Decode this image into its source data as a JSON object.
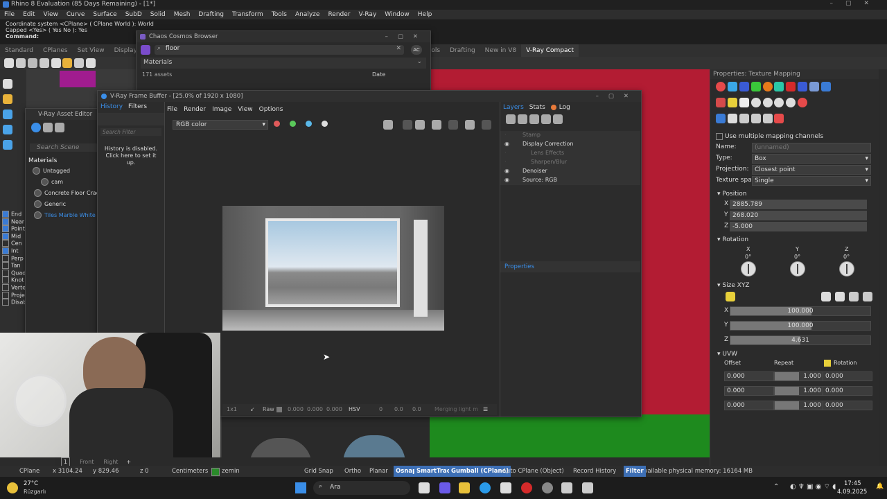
{
  "app": {
    "title": "Rhino 8 Evaluation (85 Days Remaining) - [1*]",
    "menu": [
      "File",
      "Edit",
      "View",
      "Curve",
      "Surface",
      "SubD",
      "Solid",
      "Mesh",
      "Drafting",
      "Transform",
      "Tools",
      "Analyze",
      "Render",
      "V-Ray",
      "Window",
      "Help"
    ]
  },
  "command": {
    "lines": [
      "Coordinate system <CPlane> ( CPlane World ): World",
      "Capped <Yes> ( Yes No ): Yes"
    ],
    "prompt": "Command:"
  },
  "tabs": [
    "Standard",
    "CPlanes",
    "Set View",
    "Display",
    "Tools",
    "Render Tools",
    "Drafting",
    "New in V8",
    "V-Ray Compact"
  ],
  "viewport_tabs": [
    "1",
    "Front",
    "Right"
  ],
  "osnaps": [
    {
      "label": "End",
      "checked": true
    },
    {
      "label": "Near",
      "checked": true
    },
    {
      "label": "Point",
      "checked": true
    },
    {
      "label": "Mid",
      "checked": true
    },
    {
      "label": "Cen",
      "checked": false
    },
    {
      "label": "Int",
      "checked": true
    },
    {
      "label": "Perp",
      "checked": false
    },
    {
      "label": "Tan",
      "checked": false
    },
    {
      "label": "Quad",
      "checked": false
    },
    {
      "label": "Knot",
      "checked": false
    },
    {
      "label": "Vertex",
      "checked": false
    },
    {
      "label": "Project",
      "checked": false
    },
    {
      "label": "Disable",
      "checked": false
    }
  ],
  "cosmos": {
    "title": "Chaos Cosmos Browser",
    "search": "floor",
    "badge": "AC",
    "category": "Materials",
    "count": "171 assets",
    "sort": "Date"
  },
  "asset_editor": {
    "title": "V-Ray Asset Editor",
    "search_placeholder": "Search Scene",
    "header": "Materials",
    "items": [
      "Untagged",
      "cam",
      "Concrete Floor Crack",
      "Generic",
      "Tiles Marble White"
    ]
  },
  "vfb": {
    "title": "V-Ray Frame Buffer - [25.0% of 1920 x 1080]",
    "left_tabs": [
      "History",
      "Filters"
    ],
    "search_placeholder": "Search Filter",
    "history_msg": "History is disabled. Click here to set it up.",
    "menu": [
      "File",
      "Render",
      "Image",
      "View",
      "Options"
    ],
    "channel": "RGB color",
    "right_tabs": [
      "Layers",
      "Stats",
      "Log"
    ],
    "layers": [
      {
        "label": "Stamp",
        "active": false
      },
      {
        "label": "Display Correction",
        "active": true
      },
      {
        "label": "Lens Effects",
        "active": false
      },
      {
        "label": "Sharpen/Blur",
        "active": false
      },
      {
        "label": "Denoiser",
        "active": true
      },
      {
        "label": "Source: RGB",
        "active": true
      }
    ],
    "properties_label": "Properties",
    "bottom": {
      "zoom": "1x1",
      "raw": "Raw",
      "v1": "0.000",
      "v2": "0.000",
      "v3": "0.000",
      "mode": "HSV",
      "h": "0",
      "s": "0.0",
      "v": "0.0",
      "lightmix": "Merging light m"
    }
  },
  "props": {
    "title": "Properties: Texture Mapping",
    "use_multiple": "Use multiple mapping channels",
    "name_label": "Name:",
    "name_value": "(unnamed)",
    "type_label": "Type:",
    "type_value": "Box",
    "projection_label": "Projection:",
    "projection_value": "Closest point",
    "texspace_label": "Texture space:",
    "texspace_value": "Single",
    "position_label": "Position",
    "pos": [
      {
        "axis": "X",
        "value": "2885.789"
      },
      {
        "axis": "Y",
        "value": "268.020"
      },
      {
        "axis": "Z",
        "value": "-5.000"
      }
    ],
    "rotation_label": "Rotation",
    "rot": [
      {
        "axis": "X",
        "value": "0°"
      },
      {
        "axis": "Y",
        "value": "0°"
      },
      {
        "axis": "Z",
        "value": "0°"
      }
    ],
    "size_label": "Size XYZ",
    "size": [
      {
        "axis": "X",
        "value": "100.000"
      },
      {
        "axis": "Y",
        "value": "100.000"
      },
      {
        "axis": "Z",
        "value": "4.631"
      }
    ],
    "uvw_label": "UVW",
    "uvw_headers": [
      "Offset",
      "Repeat",
      "Rotation"
    ],
    "uvw_rows": [
      [
        "0.000",
        "1.000",
        "0.000"
      ],
      [
        "0.000",
        "1.000",
        "0.000"
      ],
      [
        "0.000",
        "1.000",
        "0.000"
      ]
    ]
  },
  "status": {
    "cplane": "CPlane",
    "x": "x 3104.24",
    "y": "y 829.46",
    "z": "z 0",
    "units": "Centimeters",
    "layer": "zemin",
    "toggles": [
      {
        "label": "Grid Snap",
        "on": false
      },
      {
        "label": "Ortho",
        "on": false
      },
      {
        "label": "Planar",
        "on": false
      },
      {
        "label": "Osnap",
        "on": true
      },
      {
        "label": "SmartTrack",
        "on": true
      },
      {
        "label": "Gumball (CPlane)",
        "on": true
      },
      {
        "label": "Auto CPlane (Object)",
        "on": false
      },
      {
        "label": "Record History",
        "on": false
      },
      {
        "label": "Filter",
        "on": true
      }
    ],
    "memory": "Available physical memory: 16164 MB"
  },
  "taskbar": {
    "temp": "27°C",
    "weather": "Rüzgarlı",
    "search": "Ara",
    "time": "17:45",
    "date": "4.09.2025"
  },
  "colors": {
    "accent": "#3a7bd5",
    "viewport_red": "#b31c33",
    "viewport_green": "#1e8a1e",
    "active_toggle": "#3d6fb5"
  }
}
